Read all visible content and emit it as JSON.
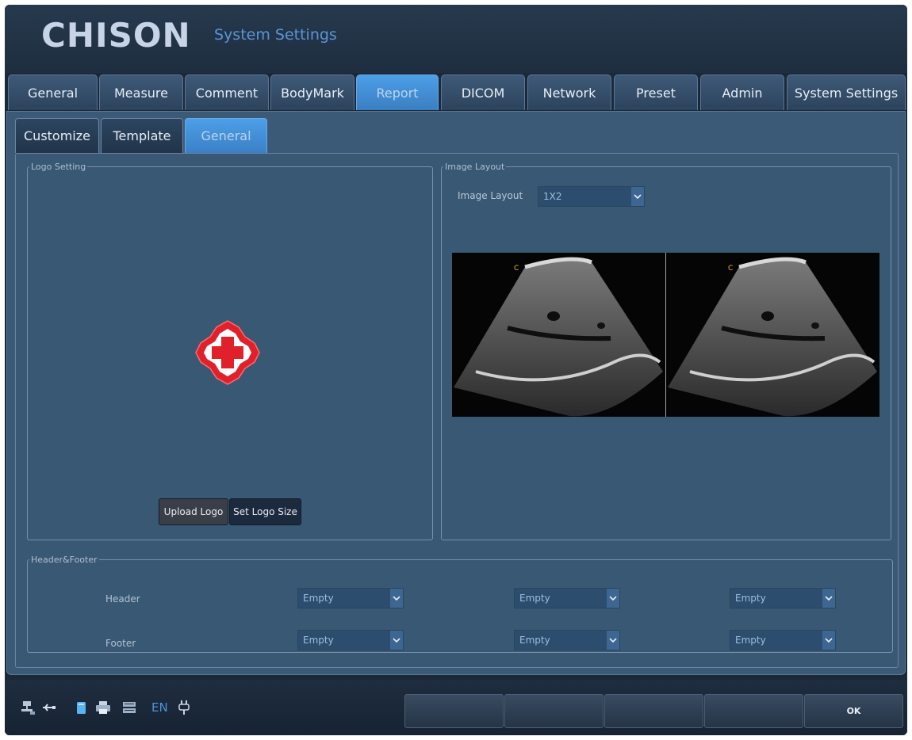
{
  "brand": {
    "logo_text": "CHISON",
    "title": "System Settings"
  },
  "main_tabs": [
    {
      "label": "General"
    },
    {
      "label": "Measure"
    },
    {
      "label": "Comment"
    },
    {
      "label": "BodyMark"
    },
    {
      "label": "Report",
      "active": true
    },
    {
      "label": "DICOM"
    },
    {
      "label": "Network"
    },
    {
      "label": "Preset"
    },
    {
      "label": "Admin"
    },
    {
      "label": "System Settings"
    }
  ],
  "sub_tabs": [
    {
      "label": "Customize"
    },
    {
      "label": "Template"
    },
    {
      "label": "General",
      "active": true
    }
  ],
  "logo_setting": {
    "legend": "Logo Setting",
    "upload_label": "Upload Logo",
    "size_label": "Set Logo Size"
  },
  "image_layout": {
    "legend": "Image Layout",
    "label": "Image Layout",
    "value": "1X2",
    "pane_marker": "C"
  },
  "header_footer": {
    "legend": "Header&Footer",
    "header_label": "Header",
    "footer_label": "Footer",
    "header_values": [
      "Empty",
      "Empty",
      "Empty"
    ],
    "footer_values": [
      "Empty",
      "Empty",
      "Empty"
    ]
  },
  "status_bar": {
    "icons": [
      "network-icon",
      "usb-icon",
      "storage-icon",
      "printer-icon",
      "keyboard-icon",
      "power-plug-icon"
    ],
    "language": "EN",
    "soft_buttons": [
      "",
      "",
      "",
      "",
      "OK"
    ]
  },
  "colors": {
    "accent": "#4c9fe8",
    "panel": "#3b5a78",
    "background": "#1a2838",
    "logo_red": "#e0202a"
  }
}
